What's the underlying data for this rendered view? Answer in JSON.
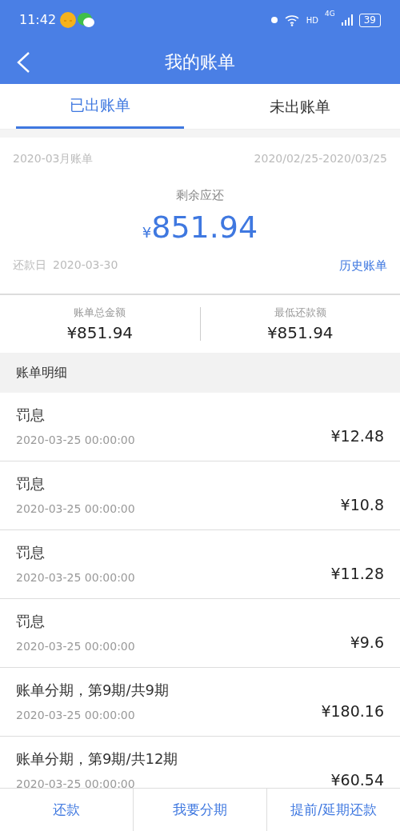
{
  "status_bar": {
    "time": "11:42",
    "network": "4G",
    "hd": "HD",
    "battery": "39"
  },
  "header": {
    "title": "我的账单"
  },
  "tabs": [
    {
      "label": "已出账单",
      "selected": true
    },
    {
      "label": "未出账单",
      "selected": false
    }
  ],
  "bill": {
    "month": "2020-03月账单",
    "period": "2020/02/25-2020/03/25",
    "remaining_label": "剩余应还",
    "currency": "¥",
    "remaining": "851.94",
    "due_label": "还款日",
    "due_date": "2020-03-30",
    "history_link": "历史账单"
  },
  "summary": [
    {
      "label": "账单总金额",
      "value": "¥851.94"
    },
    {
      "label": "最低还款额",
      "value": "¥851.94"
    }
  ],
  "details": {
    "title": "账单明细",
    "items": [
      {
        "name": "罚息",
        "time": "2020-03-25 00:00:00",
        "amount": "¥12.48"
      },
      {
        "name": "罚息",
        "time": "2020-03-25 00:00:00",
        "amount": "¥10.8"
      },
      {
        "name": "罚息",
        "time": "2020-03-25 00:00:00",
        "amount": "¥11.28"
      },
      {
        "name": "罚息",
        "time": "2020-03-25 00:00:00",
        "amount": "¥9.6"
      },
      {
        "name": "账单分期，第9期/共9期",
        "time": "2020-03-25 00:00:00",
        "amount": "¥180.16"
      },
      {
        "name": "账单分期，第9期/共12期",
        "time": "2020-03-25 00:00:00",
        "amount": "¥60.54"
      }
    ]
  },
  "actions": [
    "还款",
    "我要分期",
    "提前/延期还款"
  ]
}
